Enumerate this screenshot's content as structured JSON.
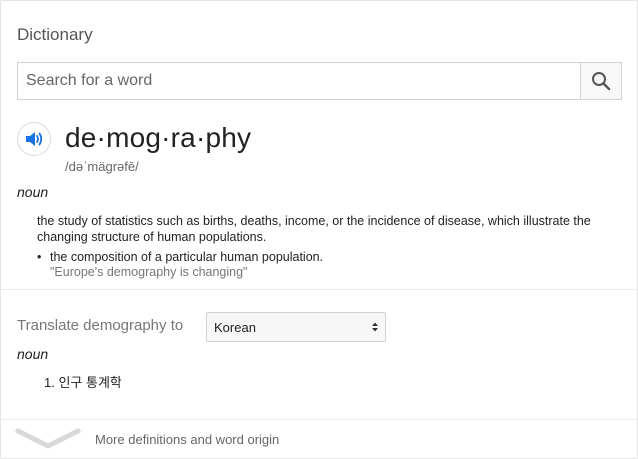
{
  "header": {
    "title": "Dictionary"
  },
  "search": {
    "placeholder": "Search for a word",
    "value": ""
  },
  "entry": {
    "headword": "de·mog·ra·phy",
    "phonetic": "/dəˈmägrəfē/",
    "part_of_speech": "noun",
    "definition": "the study of statistics such as births, deaths, income, or the incidence of disease, which illustrate the changing structure of human populations.",
    "sub_definition": {
      "bullet": "•",
      "text": "the composition of a particular human population.",
      "example": "\"Europe's demography is changing\""
    }
  },
  "translate": {
    "label": "Translate demography to",
    "selected_language": "Korean",
    "part_of_speech": "noun",
    "items": [
      {
        "number": "1.",
        "text": "인구 통계학"
      }
    ]
  },
  "footer": {
    "more_label": "More definitions and word origin"
  },
  "icons": {
    "search": "search-icon",
    "speaker": "speaker-icon",
    "expand": "chevron-down-icon",
    "select_arrows": "up-down-arrows-icon"
  },
  "colors": {
    "accent_blue": "#1a73e8",
    "text": "#222222",
    "muted": "#777777"
  }
}
